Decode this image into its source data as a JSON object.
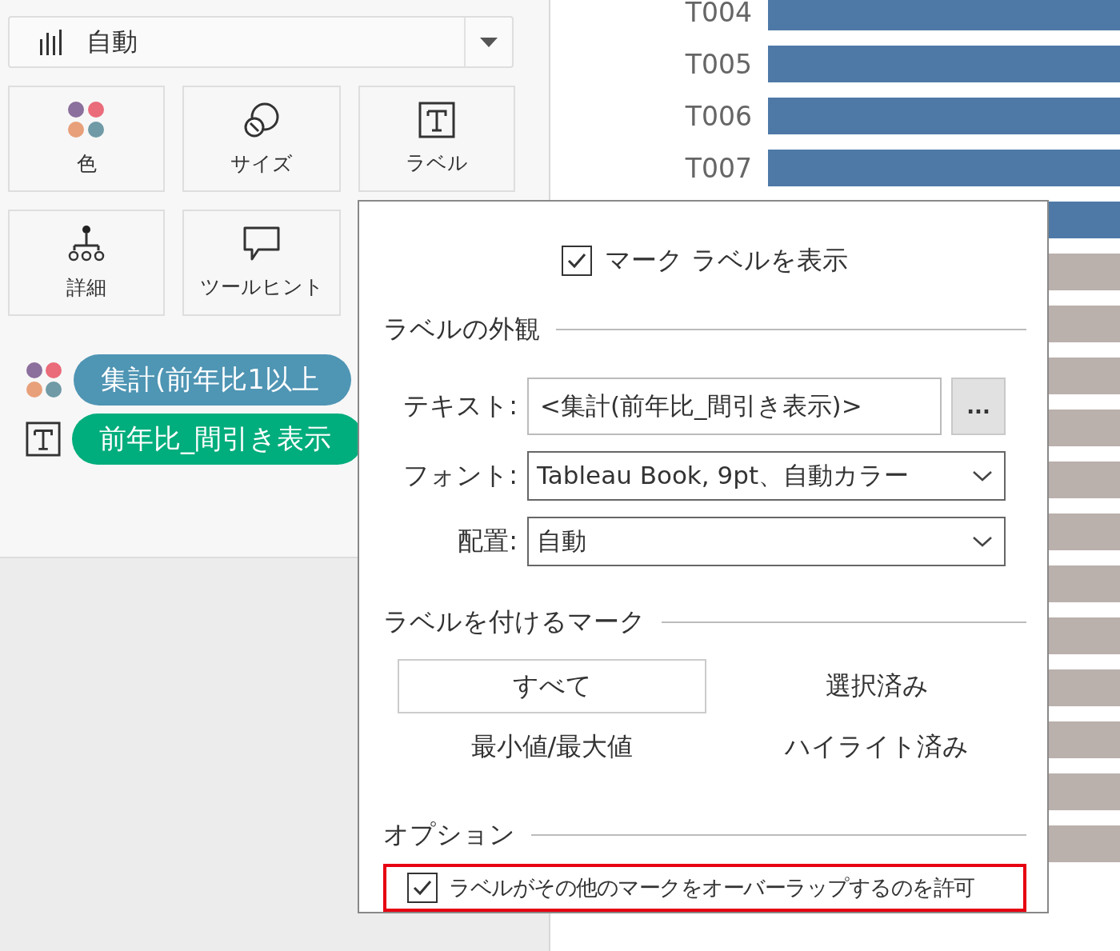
{
  "marks_card": {
    "mark_type": "自動",
    "buttons": [
      {
        "kind": "color",
        "label": "色"
      },
      {
        "kind": "size",
        "label": "サイズ"
      },
      {
        "kind": "label",
        "label": "ラベル"
      },
      {
        "kind": "detail",
        "label": "詳細"
      },
      {
        "kind": "tooltip",
        "label": "ツールヒント"
      }
    ],
    "fields": [
      {
        "kind": "color",
        "label": "集計(前年比1以上",
        "color": "#4f95b4"
      },
      {
        "kind": "label",
        "label": "前年比_間引き表示",
        "color": "#00ad7c"
      }
    ]
  },
  "chart": {
    "rows": [
      {
        "label": "T004",
        "color": "#4e79a7"
      },
      {
        "label": "T005",
        "color": "#4e79a7"
      },
      {
        "label": "T006",
        "color": "#4e79a7"
      },
      {
        "label": "T007",
        "color": "#4e79a7"
      },
      {
        "color": "#4e79a7"
      },
      {
        "color": "#bab0ac"
      },
      {
        "color": "#bab0ac"
      },
      {
        "color": "#bab0ac"
      },
      {
        "color": "#bab0ac"
      },
      {
        "color": "#bab0ac"
      },
      {
        "color": "#bab0ac"
      },
      {
        "color": "#bab0ac"
      },
      {
        "color": "#bab0ac"
      },
      {
        "color": "#bab0ac"
      },
      {
        "color": "#bab0ac"
      },
      {
        "color": "#bab0ac"
      },
      {
        "color": "#bab0ac"
      }
    ]
  },
  "label_popup": {
    "show_labels": {
      "label": "マーク ラベルを表示",
      "checked": true
    },
    "appearance": {
      "title": "ラベルの外観",
      "text": {
        "label": "テキスト:",
        "value": "<集計(前年比_間引き表示)>",
        "button": "..."
      },
      "font": {
        "label": "フォント:",
        "value": "Tableau Book, 9pt、自動カラー"
      },
      "alignment": {
        "label": "配置:",
        "value": "自動"
      }
    },
    "marks_to_label": {
      "title": "ラベルを付けるマーク",
      "options": [
        {
          "label": "すべて",
          "selected": true
        },
        {
          "label": "選択済み",
          "selected": false
        },
        {
          "label": "最小値/最大値",
          "selected": false
        },
        {
          "label": "ハイライト済み",
          "selected": false
        }
      ]
    },
    "options": {
      "title": "オプション",
      "items": [
        {
          "label": "ラベルがその他のマークをオーバーラップするのを許可",
          "checked": true,
          "highlighted": true
        }
      ]
    }
  }
}
